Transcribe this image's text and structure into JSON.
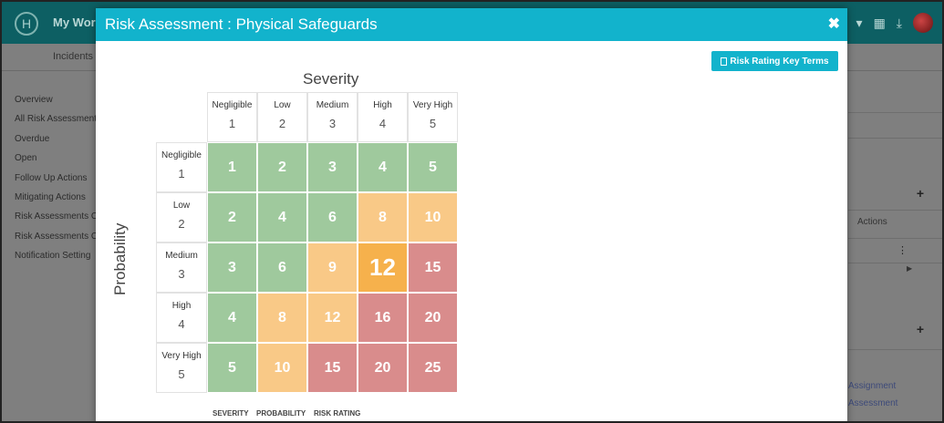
{
  "app": {
    "title": "My Work",
    "tab": "Incidents",
    "logo_text": "H",
    "icons": [
      "dropdown-caret-icon",
      "grid-icon",
      "download-icon",
      "avatar"
    ]
  },
  "side_nav": [
    "Overview",
    "All Risk Assessment",
    "Overdue",
    "Open",
    "Follow Up Actions",
    "Mitigating Actions",
    "Risk Assessments C",
    "Risk Assessments C",
    "Notification Setting"
  ],
  "background_right": {
    "actions_label": "Actions",
    "link1": "Assignment",
    "link2": "Assessment"
  },
  "modal": {
    "title": "Risk Assessment : Physical Safeguards",
    "close_symbol": "✖",
    "key_button_label": "Risk Rating Key Terms",
    "severity_label": "Severity",
    "probability_label": "Probability"
  },
  "severity_levels": [
    {
      "name": "Negligible",
      "num": "1"
    },
    {
      "name": "Low",
      "num": "2"
    },
    {
      "name": "Medium",
      "num": "3"
    },
    {
      "name": "High",
      "num": "4"
    },
    {
      "name": "Very High",
      "num": "5"
    }
  ],
  "probability_levels": [
    {
      "name": "Negligible",
      "num": "1"
    },
    {
      "name": "Low",
      "num": "2"
    },
    {
      "name": "Medium",
      "num": "3"
    },
    {
      "name": "High",
      "num": "4"
    },
    {
      "name": "Very High",
      "num": "5"
    }
  ],
  "matrix": [
    [
      "1",
      "2",
      "3",
      "4",
      "5"
    ],
    [
      "2",
      "4",
      "6",
      "8",
      "10"
    ],
    [
      "3",
      "6",
      "9",
      "12",
      "15"
    ],
    [
      "4",
      "8",
      "12",
      "16",
      "20"
    ],
    [
      "5",
      "10",
      "15",
      "20",
      "25"
    ]
  ],
  "matrix_levels": [
    [
      "low",
      "low",
      "low",
      "low",
      "low"
    ],
    [
      "low",
      "low",
      "low",
      "medium",
      "medium"
    ],
    [
      "low",
      "low",
      "medium",
      "selected",
      "high"
    ],
    [
      "low",
      "medium",
      "medium",
      "high",
      "high"
    ],
    [
      "low",
      "medium",
      "high",
      "high",
      "high"
    ]
  ],
  "colors": {
    "low": "#9fc99d",
    "medium": "#f9c987",
    "high": "#d98c8c",
    "selected": "#f6b14c",
    "header": "#12b3cc"
  },
  "legend": [
    "SEVERITY",
    "PROBABILITY",
    "RISK RATING"
  ]
}
